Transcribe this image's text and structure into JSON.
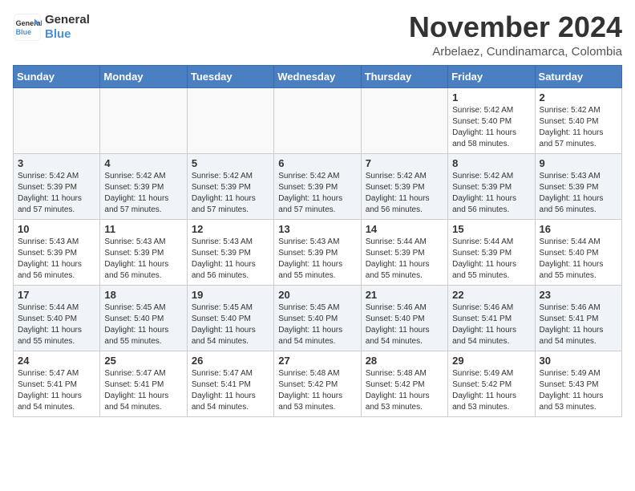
{
  "logo": {
    "line1": "General",
    "line2": "Blue"
  },
  "title": "November 2024",
  "subtitle": "Arbelaez, Cundinamarca, Colombia",
  "weekdays": [
    "Sunday",
    "Monday",
    "Tuesday",
    "Wednesday",
    "Thursday",
    "Friday",
    "Saturday"
  ],
  "weeks": [
    [
      {
        "day": "",
        "info": ""
      },
      {
        "day": "",
        "info": ""
      },
      {
        "day": "",
        "info": ""
      },
      {
        "day": "",
        "info": ""
      },
      {
        "day": "",
        "info": ""
      },
      {
        "day": "1",
        "info": "Sunrise: 5:42 AM\nSunset: 5:40 PM\nDaylight: 11 hours\nand 58 minutes."
      },
      {
        "day": "2",
        "info": "Sunrise: 5:42 AM\nSunset: 5:40 PM\nDaylight: 11 hours\nand 57 minutes."
      }
    ],
    [
      {
        "day": "3",
        "info": "Sunrise: 5:42 AM\nSunset: 5:39 PM\nDaylight: 11 hours\nand 57 minutes."
      },
      {
        "day": "4",
        "info": "Sunrise: 5:42 AM\nSunset: 5:39 PM\nDaylight: 11 hours\nand 57 minutes."
      },
      {
        "day": "5",
        "info": "Sunrise: 5:42 AM\nSunset: 5:39 PM\nDaylight: 11 hours\nand 57 minutes."
      },
      {
        "day": "6",
        "info": "Sunrise: 5:42 AM\nSunset: 5:39 PM\nDaylight: 11 hours\nand 57 minutes."
      },
      {
        "day": "7",
        "info": "Sunrise: 5:42 AM\nSunset: 5:39 PM\nDaylight: 11 hours\nand 56 minutes."
      },
      {
        "day": "8",
        "info": "Sunrise: 5:42 AM\nSunset: 5:39 PM\nDaylight: 11 hours\nand 56 minutes."
      },
      {
        "day": "9",
        "info": "Sunrise: 5:43 AM\nSunset: 5:39 PM\nDaylight: 11 hours\nand 56 minutes."
      }
    ],
    [
      {
        "day": "10",
        "info": "Sunrise: 5:43 AM\nSunset: 5:39 PM\nDaylight: 11 hours\nand 56 minutes."
      },
      {
        "day": "11",
        "info": "Sunrise: 5:43 AM\nSunset: 5:39 PM\nDaylight: 11 hours\nand 56 minutes."
      },
      {
        "day": "12",
        "info": "Sunrise: 5:43 AM\nSunset: 5:39 PM\nDaylight: 11 hours\nand 56 minutes."
      },
      {
        "day": "13",
        "info": "Sunrise: 5:43 AM\nSunset: 5:39 PM\nDaylight: 11 hours\nand 55 minutes."
      },
      {
        "day": "14",
        "info": "Sunrise: 5:44 AM\nSunset: 5:39 PM\nDaylight: 11 hours\nand 55 minutes."
      },
      {
        "day": "15",
        "info": "Sunrise: 5:44 AM\nSunset: 5:39 PM\nDaylight: 11 hours\nand 55 minutes."
      },
      {
        "day": "16",
        "info": "Sunrise: 5:44 AM\nSunset: 5:40 PM\nDaylight: 11 hours\nand 55 minutes."
      }
    ],
    [
      {
        "day": "17",
        "info": "Sunrise: 5:44 AM\nSunset: 5:40 PM\nDaylight: 11 hours\nand 55 minutes."
      },
      {
        "day": "18",
        "info": "Sunrise: 5:45 AM\nSunset: 5:40 PM\nDaylight: 11 hours\nand 55 minutes."
      },
      {
        "day": "19",
        "info": "Sunrise: 5:45 AM\nSunset: 5:40 PM\nDaylight: 11 hours\nand 54 minutes."
      },
      {
        "day": "20",
        "info": "Sunrise: 5:45 AM\nSunset: 5:40 PM\nDaylight: 11 hours\nand 54 minutes."
      },
      {
        "day": "21",
        "info": "Sunrise: 5:46 AM\nSunset: 5:40 PM\nDaylight: 11 hours\nand 54 minutes."
      },
      {
        "day": "22",
        "info": "Sunrise: 5:46 AM\nSunset: 5:41 PM\nDaylight: 11 hours\nand 54 minutes."
      },
      {
        "day": "23",
        "info": "Sunrise: 5:46 AM\nSunset: 5:41 PM\nDaylight: 11 hours\nand 54 minutes."
      }
    ],
    [
      {
        "day": "24",
        "info": "Sunrise: 5:47 AM\nSunset: 5:41 PM\nDaylight: 11 hours\nand 54 minutes."
      },
      {
        "day": "25",
        "info": "Sunrise: 5:47 AM\nSunset: 5:41 PM\nDaylight: 11 hours\nand 54 minutes."
      },
      {
        "day": "26",
        "info": "Sunrise: 5:47 AM\nSunset: 5:41 PM\nDaylight: 11 hours\nand 54 minutes."
      },
      {
        "day": "27",
        "info": "Sunrise: 5:48 AM\nSunset: 5:42 PM\nDaylight: 11 hours\nand 53 minutes."
      },
      {
        "day": "28",
        "info": "Sunrise: 5:48 AM\nSunset: 5:42 PM\nDaylight: 11 hours\nand 53 minutes."
      },
      {
        "day": "29",
        "info": "Sunrise: 5:49 AM\nSunset: 5:42 PM\nDaylight: 11 hours\nand 53 minutes."
      },
      {
        "day": "30",
        "info": "Sunrise: 5:49 AM\nSunset: 5:43 PM\nDaylight: 11 hours\nand 53 minutes."
      }
    ]
  ]
}
